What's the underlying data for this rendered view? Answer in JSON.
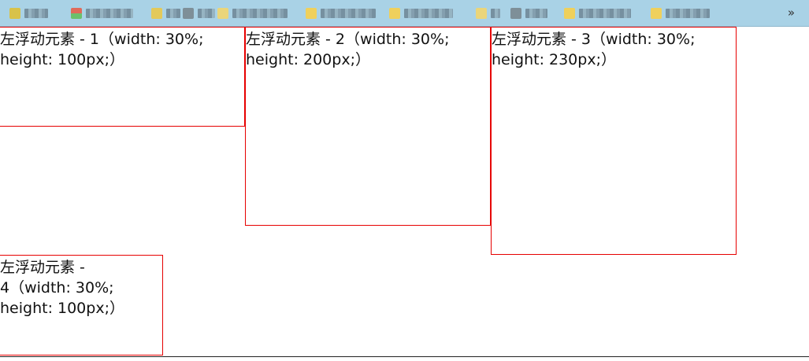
{
  "bookmarks_bar": {
    "overflow_label": "»",
    "items": [
      {
        "icon": "folder-icon",
        "icon_color": "#d8c24a"
      },
      {
        "icon": "page-icon",
        "icon_color": "#8aa1ad"
      },
      {
        "icon": "app-icon",
        "icon_color": "#e06a5a"
      },
      {
        "icon": "folder-icon",
        "icon_color": "#e3c95a"
      },
      {
        "icon": "page-icon",
        "icon_color": "#7e8f98"
      },
      {
        "icon": "folder-icon",
        "icon_color": "#ead57a"
      },
      {
        "icon": "folder-icon",
        "icon_color": "#efd05c"
      },
      {
        "icon": "folder-icon",
        "icon_color": "#efd05c"
      },
      {
        "icon": "folder-icon",
        "icon_color": "#ead57a"
      },
      {
        "icon": "page-icon",
        "icon_color": "#7e8f98"
      },
      {
        "icon": "folder-icon",
        "icon_color": "#efd05c"
      },
      {
        "icon": "folder-icon",
        "icon_color": "#efd05c"
      }
    ]
  },
  "boxes": [
    {
      "label": "左浮动元素 - 1（width: 30%; height: 100px;）",
      "line1": "左浮动元素 - 1（width: 30%;",
      "line2": "height: 100px;）"
    },
    {
      "label": "左浮动元素 - 2（width: 30%; height: 200px;）",
      "line1": "左浮动元素 - 2（width: 30%;",
      "line2": "height: 200px;）"
    },
    {
      "label": "左浮动元素 - 3（width: 30%; height: 230px;）",
      "line1": "左浮动元素 - 3（width: 30%;",
      "line2": "height: 230px;）"
    },
    {
      "label": "左浮动元素 - 4（width: 30%; height: 100px;）",
      "line1": "左浮动元素 -",
      "line2": "4（width: 30%;",
      "line3": "height: 100px;）"
    }
  ],
  "colors": {
    "box_border": "#e60000",
    "bar_background": "#a9d2e6"
  }
}
